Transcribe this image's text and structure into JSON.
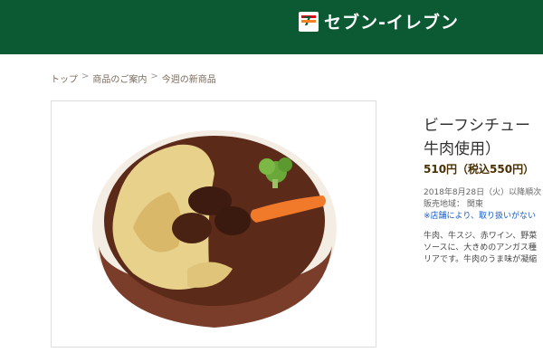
{
  "header": {
    "logo_text": "セブン-イレブン"
  },
  "breadcrumb": [
    {
      "label": "トップ"
    },
    {
      "label": "商品のご案内"
    },
    {
      "label": "今週の新商品"
    }
  ],
  "breadcrumb_separator": ">",
  "product": {
    "image_alt": "ビーフシチュー グラタン（国産牛肉使用）",
    "title_line1": "ビーフシチュー",
    "title_line2": "牛肉使用）",
    "price": "510円（税込550円）",
    "release": "2018年8月28日（火）以降順次",
    "region": "販売地域： 関東",
    "note": "※店舗により、取り扱いがない",
    "desc_line1": "牛肉、牛スジ、赤ワイン、野菜",
    "desc_line2": "ソースに、大きめのアンガス種",
    "desc_line3": "リアです。牛肉のうま味が凝縮"
  },
  "colors": {
    "header": "#0b5a33",
    "breadcrumb": "#7a6a5a",
    "link": "#1a5cc8"
  }
}
